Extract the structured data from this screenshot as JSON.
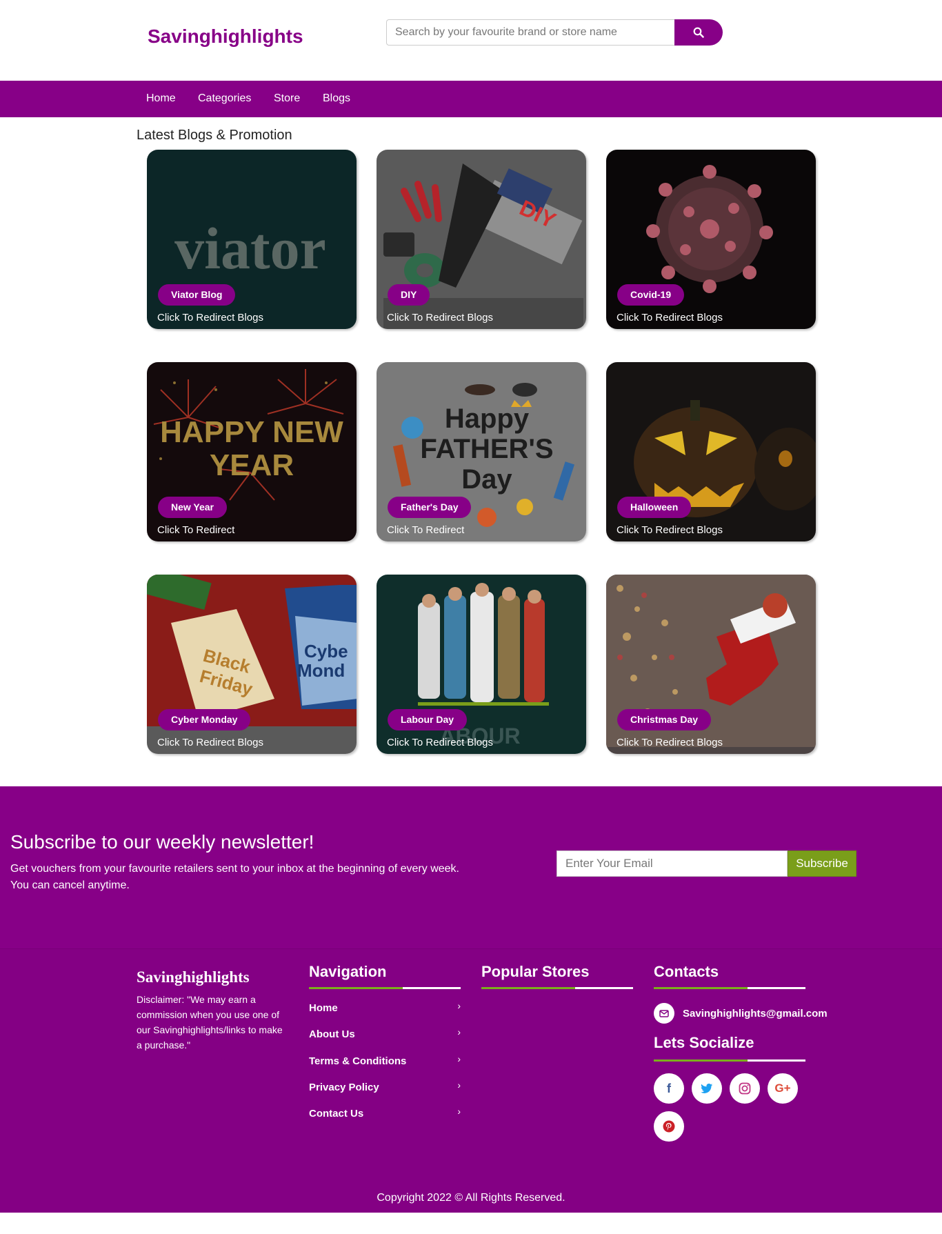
{
  "brand": "Savinghighlights",
  "search": {
    "placeholder": "Search by your favourite brand or store name"
  },
  "nav": [
    "Home",
    "Categories",
    "Store",
    "Blogs"
  ],
  "section_title": "Latest Blogs & Promotion",
  "cards": [
    {
      "tag": "Viator Blog",
      "sub": "Click To Redirect Blogs",
      "art_text": "viator"
    },
    {
      "tag": "DIY",
      "sub": "Click To Redirect Blogs",
      "art_text": "DIY"
    },
    {
      "tag": "Covid-19",
      "sub": "Click To Redirect Blogs"
    },
    {
      "tag": "New Year",
      "sub": "Click To Redirect",
      "art_text": "HAPPY NEW YEAR"
    },
    {
      "tag": "Father's Day",
      "sub": "Click To Redirect",
      "art_text": "Happy FATHER'S Day"
    },
    {
      "tag": "Halloween",
      "sub": "Click To Redirect Blogs"
    },
    {
      "tag": "Cyber Monday",
      "sub": "Click To Redirect Blogs",
      "art_text": "Black Friday Cyber Monday"
    },
    {
      "tag": "Labour Day",
      "sub": "Click To Redirect Blogs",
      "art_text": "Happy LABOUR DAY"
    },
    {
      "tag": "Christmas Day",
      "sub": "Click To Redirect Blogs"
    }
  ],
  "newsletter": {
    "title": "Subscribe to our weekly newsletter!",
    "line1": "Get vouchers from your favourite retailers sent to your inbox at the beginning of every week.",
    "line2": "You can cancel anytime.",
    "placeholder": "Enter Your Email",
    "button": "Subscribe"
  },
  "footer": {
    "brand": "Savinghighlights",
    "disclaimer": "Disclaimer: \"We may earn a commission when you use one of our Savinghighlights/links to make a purchase.\"",
    "nav_title": "Navigation",
    "nav_links": [
      "Home",
      "About Us",
      "Terms & Conditions",
      "Privacy Policy",
      "Contact Us"
    ],
    "stores_title": "Popular Stores",
    "contacts_title": "Contacts",
    "email": "Savinghighlights@gmail.com",
    "social_title": "Lets Socialize",
    "social": [
      "facebook-icon",
      "twitter-icon",
      "instagram-icon",
      "google-plus-icon",
      "pinterest-icon"
    ],
    "copyright": "Copyright 2022 © All Rights Reserved."
  },
  "colors": {
    "brand": "#870087",
    "accent_green": "#7cae1c",
    "subscribe": "#7a9e1a"
  }
}
